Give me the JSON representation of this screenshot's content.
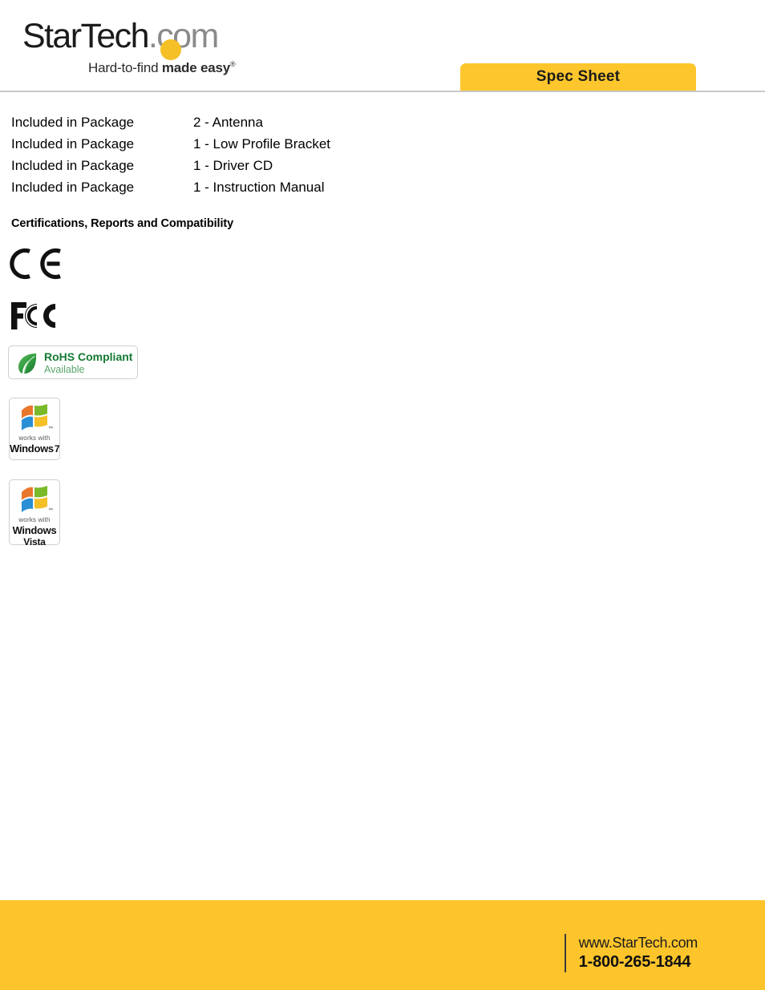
{
  "header": {
    "logo": {
      "brand_dark": "StarTech",
      "brand_gray": ".com",
      "dot_color": "#f5c026",
      "tagline_regular": "Hard-to-find ",
      "tagline_bold": "made easy",
      "tagline_registered": "®"
    },
    "banner": {
      "label": "Spec Sheet",
      "color": "#fcc62c"
    }
  },
  "package": {
    "rows": [
      {
        "label": "Included in Package",
        "value": "2 - Antenna"
      },
      {
        "label": "Included in Package",
        "value": "1 - Low Profile Bracket"
      },
      {
        "label": "Included in Package",
        "value": "1 - Driver CD"
      },
      {
        "label": "Included in Package",
        "value": "1 - Instruction Manual"
      }
    ]
  },
  "certifications": {
    "heading": "Certifications, Reports and Compatibility",
    "marks": [
      {
        "name": "ce-mark",
        "label": "CE"
      },
      {
        "name": "fcc-mark",
        "label": "FCC"
      }
    ],
    "rohs": {
      "title": "RoHS Compliant",
      "subtitle": "Available",
      "title_color": "#147a33",
      "subtitle_color": "#5aa56a"
    },
    "windows7": {
      "works_with": "works with",
      "name": "Windows",
      "version": "7"
    },
    "windows_vista": {
      "works_with": "works with",
      "name": "Windows",
      "version": "Vista"
    }
  },
  "footer": {
    "url": "www.StarTech.com",
    "phone": "1-800-265-1844",
    "background": "#fdc52b"
  }
}
